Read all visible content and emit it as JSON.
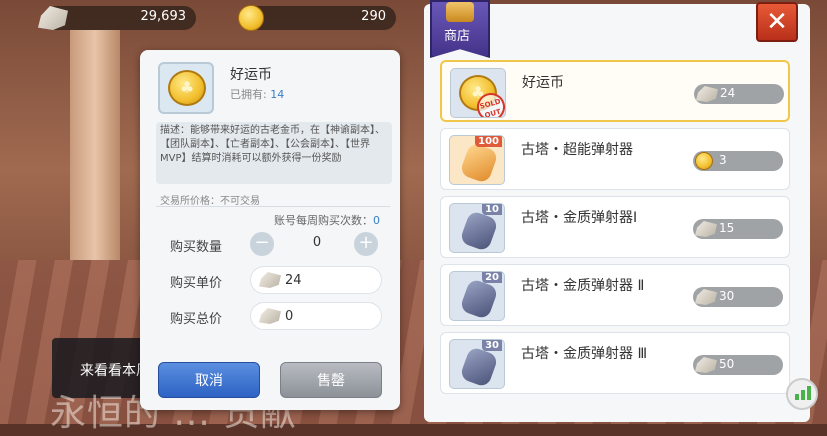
{
  "currencies": [
    {
      "icon": "ore-icon",
      "value": "29,693"
    },
    {
      "icon": "gold-coin-icon",
      "value": "290"
    }
  ],
  "background": {
    "toast_text": "来看看本周",
    "bottom_text": "永恒的 ... 贡献"
  },
  "detail": {
    "item_name": "好运币",
    "owned_label": "已拥有:",
    "owned_value": "14",
    "description": "描述：能够带来好运的古老金币，在【神谕副本】、【团队副本】、【亡者副本】、【公会副本】、【世界MVP】结算时消耗可以额外获得一份奖励",
    "trade_price": "交易所价格：不可交易",
    "weekly_limit_label": "账号每周购买次数：",
    "weekly_limit_value": "0",
    "quantity_label": "购买数量",
    "quantity_value": "0",
    "unit_price_label": "购买单价",
    "unit_price_value": "24",
    "total_price_label": "购买总价",
    "total_price_value": "0",
    "cancel_label": "取消",
    "sell_label": "售罄"
  },
  "shop": {
    "title": "商店",
    "close_label": "✕",
    "items": [
      {
        "name": "好运币",
        "price": "24",
        "currency": "ore",
        "badge": "",
        "sold_out": "SOLD OUT"
      },
      {
        "name": "古塔・超能弹射器",
        "price": "3",
        "currency": "gold",
        "badge": "100"
      },
      {
        "name": "古塔・金质弹射器Ⅰ",
        "price": "15",
        "currency": "ore",
        "badge": "10"
      },
      {
        "name": "古塔・金质弹射器 Ⅱ",
        "price": "30",
        "currency": "ore",
        "badge": "20"
      },
      {
        "name": "古塔・金质弹射器 Ⅲ",
        "price": "50",
        "currency": "ore",
        "badge": "30"
      }
    ]
  },
  "colors": {
    "accent_blue": "#2e62c4",
    "selected_border": "#f1c74a",
    "close_red": "#c8381e"
  }
}
